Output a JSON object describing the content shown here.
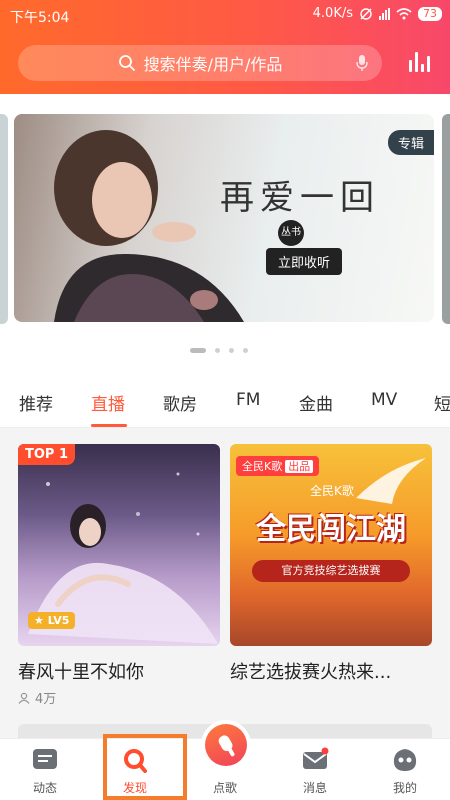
{
  "status": {
    "time": "下午5:04",
    "speed": "4.0K/s",
    "battery": "73"
  },
  "search": {
    "placeholder": "搜索伴奏/用户/作品"
  },
  "banner": {
    "tag": "专辑",
    "title": "再爱一回",
    "subtitle": "丛书",
    "button": "立即收听"
  },
  "tabs": [
    "推荐",
    "直播",
    "歌房",
    "FM",
    "金曲",
    "MV",
    "短"
  ],
  "active_tab": "直播",
  "cards": [
    {
      "badge": "TOP 1",
      "level": "LV5",
      "title": "春风十里不如你",
      "listeners": "4万"
    },
    {
      "brand": "全民K歌",
      "brand_badge": "出品",
      "brand_mini": "全民K歌",
      "poster_title": "全民闯江湖",
      "poster_band": "官方竞技综艺选拔赛",
      "title": "综艺选拔赛火热来..."
    }
  ],
  "bottom_nav": [
    {
      "label": "动态",
      "icon": "feed-icon"
    },
    {
      "label": "发现",
      "icon": "discover-icon"
    },
    {
      "label": "点歌",
      "icon": "mic-song-icon"
    },
    {
      "label": "消息",
      "icon": "message-icon"
    },
    {
      "label": "我的",
      "icon": "profile-icon"
    }
  ],
  "colors": {
    "accent": "#ff5a3c",
    "header_start": "#ff6a2b",
    "header_end": "#f8486a",
    "highlight_frame": "#f47c2a"
  }
}
